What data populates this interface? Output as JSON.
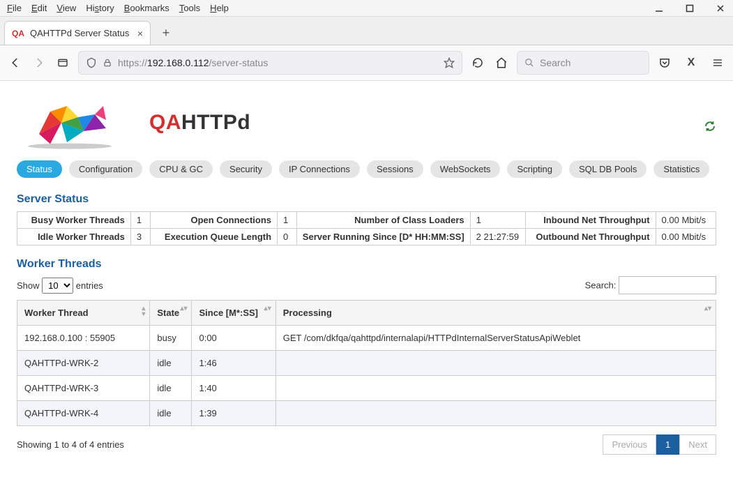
{
  "browser": {
    "menus": [
      "File",
      "Edit",
      "View",
      "History",
      "Bookmarks",
      "Tools",
      "Help"
    ],
    "tab_favicon_text": "QA",
    "tab_title": "QAHTTPd Server Status",
    "url_prefix": "https://",
    "url_host": "192.168.0.112",
    "url_path": "/server-status",
    "search_placeholder": "Search"
  },
  "app": {
    "logo_text_qa": "QA",
    "logo_text_rest": "HTTPd",
    "nav": [
      {
        "label": "Status",
        "active": true
      },
      {
        "label": "Configuration"
      },
      {
        "label": "CPU & GC"
      },
      {
        "label": "Security"
      },
      {
        "label": "IP Connections"
      },
      {
        "label": "Sessions"
      },
      {
        "label": "WebSockets"
      },
      {
        "label": "Scripting"
      },
      {
        "label": "SQL DB Pools"
      },
      {
        "label": "Statistics"
      }
    ]
  },
  "status_section": {
    "title": "Server Status",
    "rows": [
      [
        {
          "label": "Busy Worker Threads",
          "value": "1"
        },
        {
          "label": "Open Connections",
          "value": "1"
        },
        {
          "label": "Number of Class Loaders",
          "value": "1"
        },
        {
          "label": "Inbound Net Throughput",
          "value": "0.00 Mbit/s"
        }
      ],
      [
        {
          "label": "Idle Worker Threads",
          "value": "3"
        },
        {
          "label": "Execution Queue Length",
          "value": "0"
        },
        {
          "label": "Server Running Since [D* HH:MM:SS]",
          "value": "2 21:27:59"
        },
        {
          "label": "Outbound Net Throughput",
          "value": "0.00 Mbit/s"
        }
      ]
    ]
  },
  "workers_section": {
    "title": "Worker Threads",
    "show_label_pre": "Show",
    "show_label_post": "entries",
    "show_value": "10",
    "search_label": "Search:",
    "columns": [
      "Worker Thread",
      "State",
      "Since [M*:SS]",
      "Processing"
    ],
    "rows": [
      {
        "thread": "192.168.0.100 : 55905",
        "state": "busy",
        "since": "0:00",
        "processing": "GET /com/dkfqa/qahttpd/internalapi/HTTPdInternalServerStatusApiWeblet"
      },
      {
        "thread": "QAHTTPd-WRK-2",
        "state": "idle",
        "since": "1:46",
        "processing": ""
      },
      {
        "thread": "QAHTTPd-WRK-3",
        "state": "idle",
        "since": "1:40",
        "processing": ""
      },
      {
        "thread": "QAHTTPd-WRK-4",
        "state": "idle",
        "since": "1:39",
        "processing": ""
      }
    ],
    "info_text": "Showing 1 to 4 of 4 entries",
    "paginate": {
      "prev": "Previous",
      "current": "1",
      "next": "Next"
    }
  }
}
